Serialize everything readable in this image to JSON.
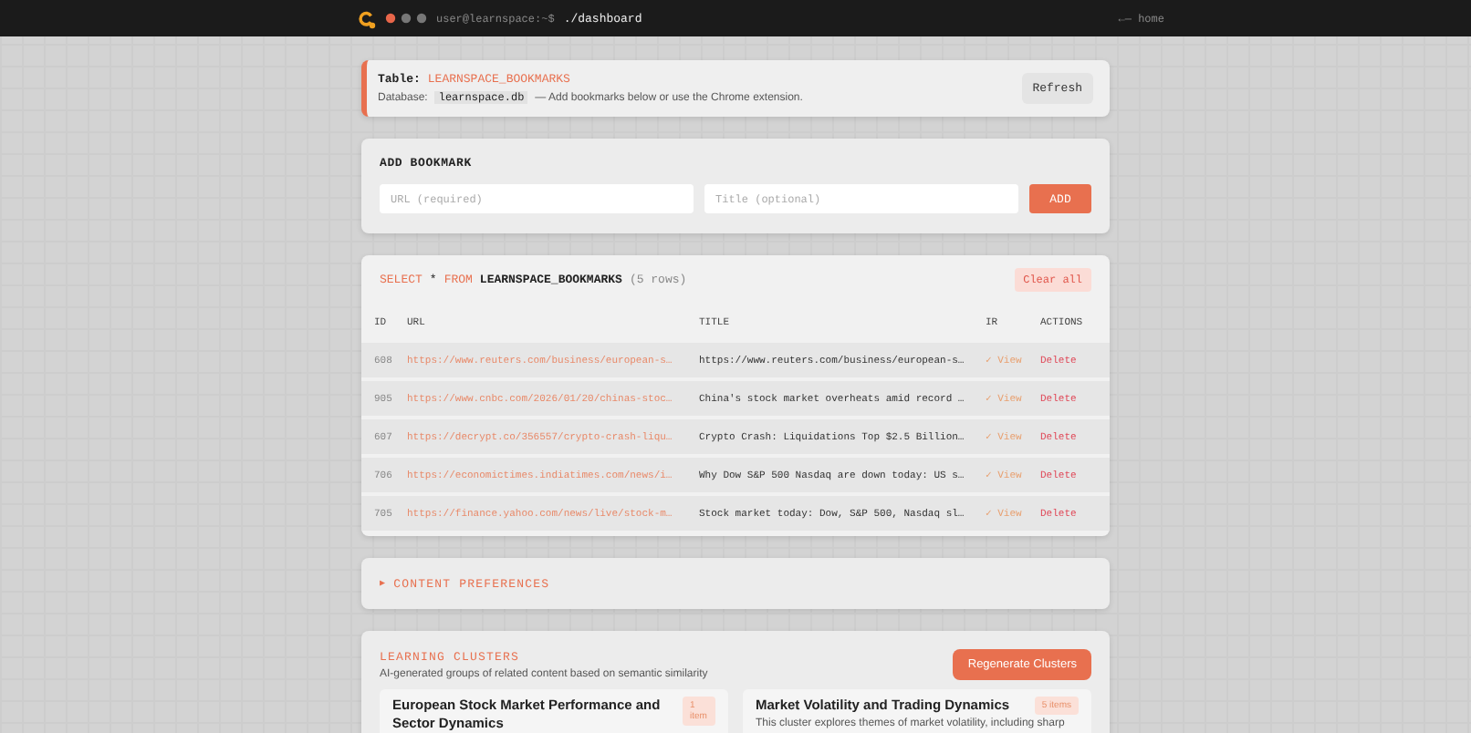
{
  "topbar": {
    "prompt": "user@learnspace:~$",
    "command": "./dashboard",
    "home_link": "←— home"
  },
  "info": {
    "table_label": "Table:",
    "table_name": "LEARNSPACE_BOOKMARKS",
    "database_label": "Database:",
    "database_name": "learnspace.db",
    "note": "— Add bookmarks below or use the Chrome extension.",
    "refresh_button": "Refresh"
  },
  "add_bookmark": {
    "heading": "ADD BOOKMARK",
    "url_field": {
      "placeholder": "URL (required)"
    },
    "title_field": {
      "placeholder": "Title (optional)"
    },
    "add_button": "ADD"
  },
  "bookmarks": {
    "query": [
      {
        "kind": "keyword",
        "text": "SELECT"
      },
      {
        "kind": "plain",
        "text": "*"
      },
      {
        "kind": "keyword",
        "text": "FROM"
      },
      {
        "kind": "table",
        "text": "LEARNSPACE_BOOKMARKS"
      }
    ],
    "row_count": "(5 rows)",
    "clear_button": "Clear all",
    "columns": [
      "ID",
      "URL",
      "TITLE",
      "IR",
      "ACTIONS"
    ],
    "rows": [
      {
        "id": "608",
        "url": "https://www.reuters.com/business/european-s…",
        "title": "https://www.reuters.com/business/european-s…",
        "ir": "✓ View",
        "action": "Delete"
      },
      {
        "id": "905",
        "url": "https://www.cnbc.com/2026/01/20/chinas-stoc…",
        "title": "China's stock market overheats amid record …",
        "ir": "✓ View",
        "action": "Delete"
      },
      {
        "id": "607",
        "url": "https://decrypt.co/356557/crypto-crash-liqu…",
        "title": "Crypto Crash: Liquidations Top $2.5 Billion…",
        "ir": "✓ View",
        "action": "Delete"
      },
      {
        "id": "706",
        "url": "https://economictimes.indiatimes.com/news/i…",
        "title": "Why Dow S&P 500 Nasdaq are down today: US s…",
        "ir": "✓ View",
        "action": "Delete"
      },
      {
        "id": "705",
        "url": "https://finance.yahoo.com/news/live/stock-m…",
        "title": "Stock market today: Dow, S&P 500, Nasdaq sl…",
        "ir": "✓ View",
        "action": "Delete"
      }
    ]
  },
  "preferences": {
    "expanded": false,
    "arrow": "▶",
    "label": "CONTENT PREFERENCES"
  },
  "clusters": {
    "heading": "LEARNING CLUSTERS",
    "subtitle": "AI-generated groups of related content based on semantic similarity",
    "regenerate_button": "Regenerate Clusters",
    "cards": [
      {
        "title": "European Stock Market Performance and Sector Dynamics",
        "count": "1 item"
      },
      {
        "title": "Market Volatility and Trading Dynamics",
        "count": "5 items",
        "description": "This cluster explores themes of market volatility, including sharp"
      }
    ]
  }
}
